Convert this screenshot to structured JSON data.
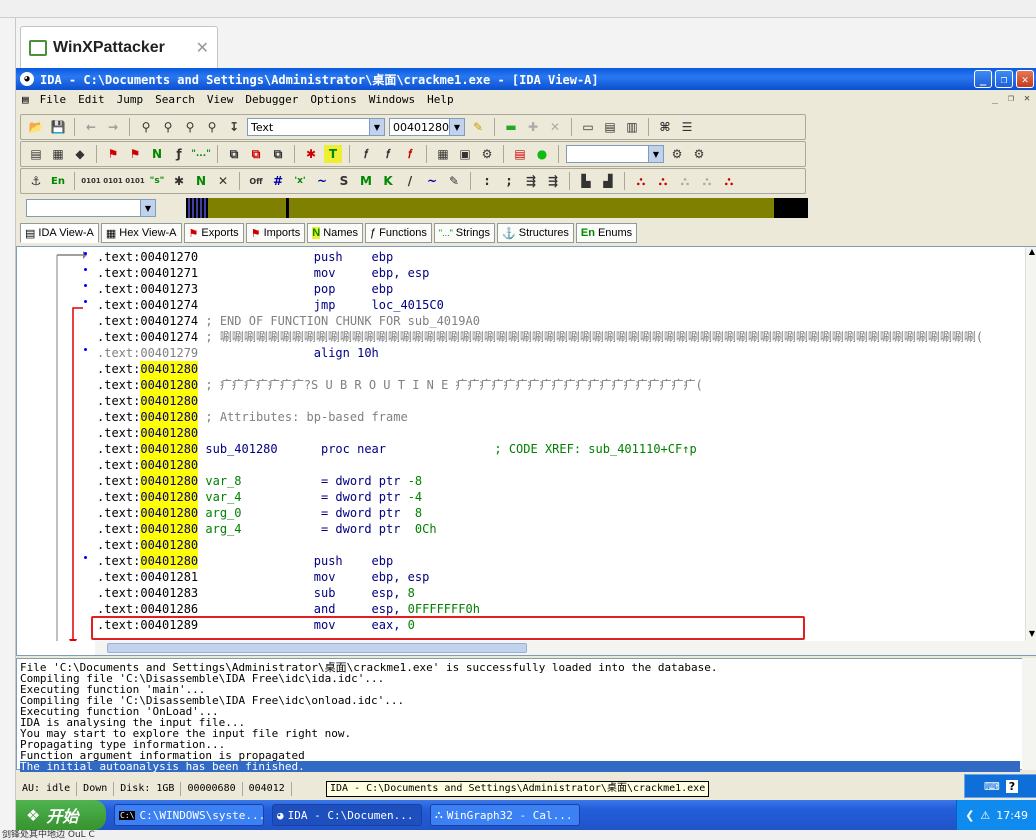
{
  "vm_tab": {
    "title": "WinXPattacker"
  },
  "ida": {
    "title": "IDA - C:\\Documents and Settings\\Administrator\\桌面\\crackme1.exe - [IDA View-A]",
    "menu": [
      "File",
      "Edit",
      "Jump",
      "Search",
      "View",
      "Debugger",
      "Options",
      "Windows",
      "Help"
    ],
    "toolbar": {
      "search_type": "Text",
      "address": "00401280"
    },
    "view_tabs": [
      "IDA View-A",
      "Hex View-A",
      "Exports",
      "Imports",
      "Names",
      "Functions",
      "Strings",
      "Structures",
      "Enums"
    ],
    "disasm": [
      {
        "seg": ".text:",
        "addr": "00401270",
        "hl": false,
        "body": [
          [
            "",
            "                "
          ],
          [
            "mn",
            "push    "
          ],
          [
            "op",
            "ebp"
          ]
        ]
      },
      {
        "seg": ".text:",
        "addr": "00401271",
        "hl": false,
        "body": [
          [
            "",
            "                "
          ],
          [
            "mn",
            "mov     "
          ],
          [
            "op",
            "ebp, esp"
          ]
        ]
      },
      {
        "seg": ".text:",
        "addr": "00401273",
        "hl": false,
        "body": [
          [
            "",
            "                "
          ],
          [
            "mn",
            "pop     "
          ],
          [
            "op",
            "ebp"
          ]
        ]
      },
      {
        "seg": ".text:",
        "addr": "00401274",
        "hl": false,
        "body": [
          [
            "",
            "                "
          ],
          [
            "mn",
            "jmp     "
          ],
          [
            "op",
            "loc_4015C0"
          ]
        ]
      },
      {
        "seg": ".text:",
        "addr": "00401274",
        "hl": false,
        "body": [
          [
            "cmt",
            " ; END OF FUNCTION CHUNK FOR sub_4019A0"
          ]
        ]
      },
      {
        "seg": ".text:",
        "addr": "00401274",
        "hl": false,
        "body": [
          [
            "cmt",
            " ; 唰唰唰唰唰唰唰唰唰唰唰唰唰唰唰唰唰唰唰唰唰唰唰唰唰唰唰唰唰唰唰唰唰唰唰唰唰唰唰唰唰唰唰唰唰唰唰唰唰唰唰唰唰唰唰唰唰唰唰唰唰唰唰("
          ]
        ]
      },
      {
        "seg": ".text:",
        "addr": "00401279",
        "hl": false,
        "gray": true,
        "body": [
          [
            "",
            "                "
          ],
          [
            "mn",
            "align 10h"
          ]
        ]
      },
      {
        "seg": ".text:",
        "addr": "00401280",
        "hl": true,
        "body": []
      },
      {
        "seg": ".text:",
        "addr": "00401280",
        "hl": true,
        "body": [
          [
            "cmt",
            " ; 疒疒疒疒疒疒疒?S U B R O U T I N E 疒疒疒疒疒疒疒疒疒疒疒疒疒疒疒疒疒疒疒疒("
          ]
        ]
      },
      {
        "seg": ".text:",
        "addr": "00401280",
        "hl": true,
        "body": []
      },
      {
        "seg": ".text:",
        "addr": "00401280",
        "hl": true,
        "body": [
          [
            "cmt",
            " ; Attributes: bp-based frame"
          ]
        ]
      },
      {
        "seg": ".text:",
        "addr": "00401280",
        "hl": true,
        "body": []
      },
      {
        "seg": ".text:",
        "addr": "00401280",
        "hl": true,
        "body": [
          [
            "lbl",
            " sub_401280      "
          ],
          [
            "mn",
            "proc near               "
          ],
          [
            "num",
            "; CODE XREF: sub_401110+CF↑p"
          ]
        ]
      },
      {
        "seg": ".text:",
        "addr": "00401280",
        "hl": true,
        "body": []
      },
      {
        "seg": ".text:",
        "addr": "00401280",
        "hl": true,
        "body": [
          [
            "num",
            " var_8           "
          ],
          [
            "mn",
            "= dword ptr "
          ],
          [
            "num",
            "-8"
          ]
        ]
      },
      {
        "seg": ".text:",
        "addr": "00401280",
        "hl": true,
        "body": [
          [
            "num",
            " var_4           "
          ],
          [
            "mn",
            "= dword ptr "
          ],
          [
            "num",
            "-4"
          ]
        ]
      },
      {
        "seg": ".text:",
        "addr": "00401280",
        "hl": true,
        "body": [
          [
            "num",
            " arg_0           "
          ],
          [
            "mn",
            "= dword ptr  "
          ],
          [
            "num",
            "8"
          ]
        ]
      },
      {
        "seg": ".text:",
        "addr": "00401280",
        "hl": true,
        "body": [
          [
            "num",
            " arg_4           "
          ],
          [
            "mn",
            "= dword ptr  "
          ],
          [
            "num",
            "0Ch"
          ]
        ]
      },
      {
        "seg": ".text:",
        "addr": "00401280",
        "hl": true,
        "body": []
      },
      {
        "seg": ".text:",
        "addr": "00401280",
        "hl": true,
        "body": [
          [
            "",
            "                "
          ],
          [
            "mn",
            "push    "
          ],
          [
            "op",
            "ebp"
          ]
        ]
      },
      {
        "seg": ".text:",
        "addr": "00401281",
        "hl": false,
        "body": [
          [
            "",
            "                "
          ],
          [
            "mn",
            "mov     "
          ],
          [
            "op",
            "ebp, esp"
          ]
        ]
      },
      {
        "seg": ".text:",
        "addr": "00401283",
        "hl": false,
        "body": [
          [
            "",
            "                "
          ],
          [
            "mn",
            "sub     "
          ],
          [
            "op",
            "esp, "
          ],
          [
            "num",
            "8"
          ]
        ]
      },
      {
        "seg": ".text:",
        "addr": "00401286",
        "hl": false,
        "body": [
          [
            "",
            "                "
          ],
          [
            "mn",
            "and     "
          ],
          [
            "op",
            "esp, "
          ],
          [
            "num",
            "0FFFFFFF0h"
          ]
        ]
      },
      {
        "seg": ".text:",
        "addr": "00401289",
        "hl": false,
        "body": [
          [
            "",
            "                "
          ],
          [
            "mn",
            "mov     "
          ],
          [
            "op",
            "eax, "
          ],
          [
            "num",
            "0"
          ]
        ]
      }
    ],
    "output": [
      "File 'C:\\Documents and Settings\\Administrator\\桌面\\crackme1.exe' is successfully loaded into the database.",
      "Compiling file 'C:\\Disassemble\\IDA Free\\idc\\ida.idc'...",
      "Executing function 'main'...",
      "Compiling file 'C:\\Disassemble\\IDA Free\\idc\\onload.idc'...",
      "Executing function 'OnLoad'...",
      "IDA is analysing the input file...",
      "You may start to explore the input file right now.",
      "Propagating type information...",
      "Function argument information is propagated",
      "The initial autoanalysis has been finished."
    ],
    "status": {
      "au": "AU:  idle",
      "dir": "Down",
      "disk": "Disk: 1GB",
      "offset": "00000680",
      "addr": "004012"
    },
    "tooltip": "IDA - C:\\Documents and Settings\\Administrator\\桌面\\crackme1.exe"
  },
  "taskbar": {
    "start": "开始",
    "tasks": [
      "C:\\WINDOWS\\syste...",
      "IDA - C:\\Documen...",
      "WinGraph32 - Cal..."
    ],
    "clock": "17:49"
  },
  "bottom_text": "剑锋处其中地边 OuL C"
}
